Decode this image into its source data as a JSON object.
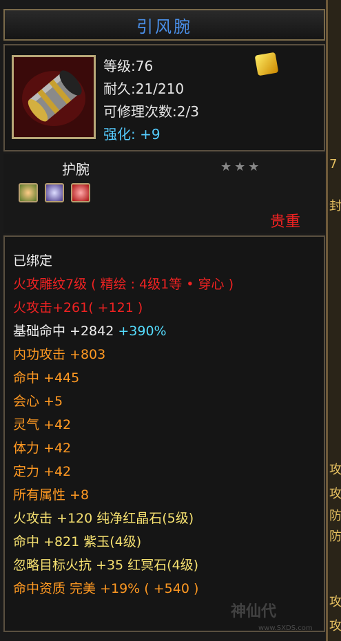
{
  "item": {
    "name": "引风腕",
    "level": "等级:76",
    "durability": "耐久:21/210",
    "repairs": "可修理次数:2/3",
    "enhance_label": "强化:",
    "enhance_value": "+9",
    "type": "护腕",
    "stars": "★★★",
    "rarity": "贵重"
  },
  "stats": {
    "bound": "已绑定",
    "engrave": "火攻雕纹7级 ( 精绘 : 4级1等 • 穿心 )",
    "fire_attack_a": "火攻击+261",
    "fire_attack_b": "( +121 )",
    "base_hit_a": "基础命中 +2842",
    "base_hit_b": "+390%",
    "inner_attack": "内功攻击 +803",
    "hit": "命中 +445",
    "crit": "会心 +5",
    "spirit": "灵气 +42",
    "stamina": "体力 +42",
    "focus": "定力 +42",
    "all_attr": "所有属性 +8",
    "gem1": "火攻击 +120 纯净红晶石(5级)",
    "gem2": "命中 +821 紫玉(4级)",
    "gem3": "忽略目标火抗 +35 红冥石(4级)",
    "quality": "命中资质 完美 +19% ( +540 )"
  },
  "sidebar": [
    "7",
    "封",
    "攻",
    "攻",
    "防",
    "防",
    "攻",
    "攻"
  ],
  "watermark": {
    "text": "神仙代",
    "url": "www.SXDS.com"
  },
  "icons": [
    "gold-gem-icon",
    "bracer-item-icon",
    "socket-green-gem-icon",
    "socket-purple-gem-icon",
    "socket-red-gem-icon"
  ]
}
